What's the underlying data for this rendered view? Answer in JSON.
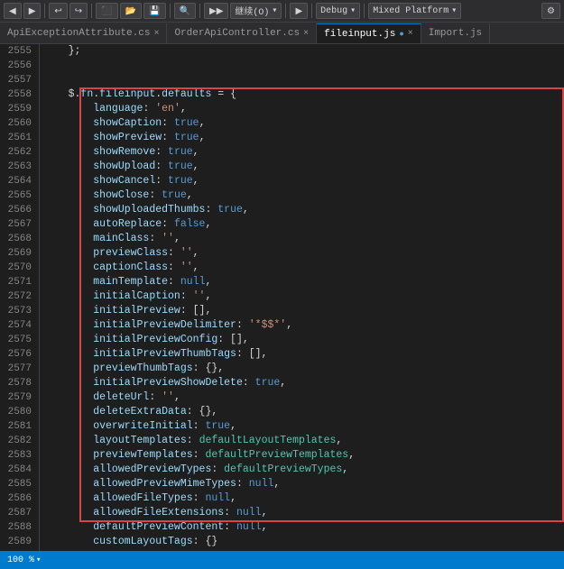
{
  "toolbar": {
    "items": [
      {
        "label": "◀",
        "type": "nav"
      },
      {
        "label": "▶",
        "type": "nav"
      },
      {
        "label": "↩",
        "type": "nav"
      },
      {
        "label": "⬛▾",
        "type": "combo"
      },
      {
        "label": "💾",
        "type": "action"
      },
      {
        "label": "📁",
        "type": "action"
      },
      {
        "label": "🔍",
        "type": "action"
      },
      {
        "label": "▶▶",
        "type": "action"
      },
      {
        "label": "继续(O)",
        "type": "combo"
      },
      {
        "label": "▶",
        "type": "action"
      },
      {
        "label": "Debug",
        "type": "combo"
      },
      {
        "label": "Mixed Platform",
        "type": "combo"
      }
    ]
  },
  "tabs": [
    {
      "label": "ApiExceptionAttribute.cs",
      "active": false,
      "modified": false
    },
    {
      "label": "OrderApiController.cs",
      "active": false,
      "modified": false
    },
    {
      "label": "fileinput.js",
      "active": true,
      "modified": true
    },
    {
      "label": "Import.js",
      "active": false,
      "modified": false
    }
  ],
  "lines": [
    {
      "num": "2555",
      "code": "    };"
    },
    {
      "num": "2556",
      "code": ""
    },
    {
      "num": "2557",
      "code": ""
    },
    {
      "num": "2558",
      "code": "    $.fn.fileinput.defaults = {"
    },
    {
      "num": "2559",
      "code": "        language: 'en',"
    },
    {
      "num": "2560",
      "code": "        showCaption: true,"
    },
    {
      "num": "2561",
      "code": "        showPreview: true,"
    },
    {
      "num": "2562",
      "code": "        showRemove: true,"
    },
    {
      "num": "2563",
      "code": "        showUpload: true,"
    },
    {
      "num": "2564",
      "code": "        showCancel: true,"
    },
    {
      "num": "2565",
      "code": "        showClose: true,"
    },
    {
      "num": "2566",
      "code": "        showUploadedThumbs: true,"
    },
    {
      "num": "2567",
      "code": "        autoReplace: false,"
    },
    {
      "num": "2568",
      "code": "        mainClass: '',"
    },
    {
      "num": "2569",
      "code": "        previewClass: '',"
    },
    {
      "num": "2570",
      "code": "        captionClass: '',"
    },
    {
      "num": "2571",
      "code": "        mainTemplate: null,"
    },
    {
      "num": "2572",
      "code": "        initialCaption: '',"
    },
    {
      "num": "2573",
      "code": "        initialPreview: [],"
    },
    {
      "num": "2574",
      "code": "        initialPreviewDelimiter: '*$$*',"
    },
    {
      "num": "2575",
      "code": "        initialPreviewConfig: [],"
    },
    {
      "num": "2576",
      "code": "        initialPreviewThumbTags: [],"
    },
    {
      "num": "2577",
      "code": "        previewThumbTags: {},"
    },
    {
      "num": "2578",
      "code": "        initialPreviewShowDelete: true,"
    },
    {
      "num": "2579",
      "code": "        deleteUrl: '',"
    },
    {
      "num": "2580",
      "code": "        deleteExtraData: {},"
    },
    {
      "num": "2581",
      "code": "        overwriteInitial: true,"
    },
    {
      "num": "2582",
      "code": "        layoutTemplates: defaultLayoutTemplates,"
    },
    {
      "num": "2583",
      "code": "        previewTemplates: defaultPreviewTemplates,"
    },
    {
      "num": "2584",
      "code": "        allowedPreviewTypes: defaultPreviewTypes,"
    },
    {
      "num": "2585",
      "code": "        allowedPreviewMimeTypes: null,"
    },
    {
      "num": "2586",
      "code": "        allowedFileTypes: null,"
    },
    {
      "num": "2587",
      "code": "        allowedFileExtensions: null,"
    },
    {
      "num": "2588",
      "code": "        defaultPreviewContent: null,"
    },
    {
      "num": "2589",
      "code": "        customLayoutTags: {}"
    }
  ],
  "statusbar": {
    "zoom": "100 %",
    "zoom_icon": "▾"
  }
}
